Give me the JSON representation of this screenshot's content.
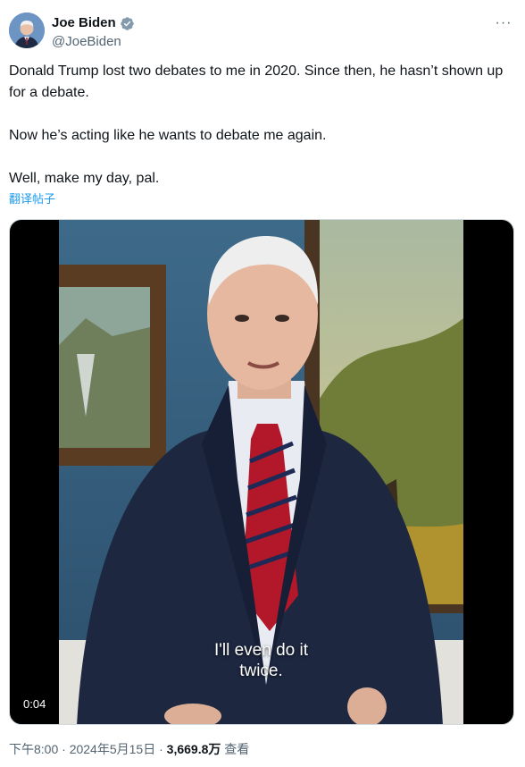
{
  "author": {
    "display_name": "Joe Biden",
    "handle": "@JoeBiden"
  },
  "icons": {
    "verified": "verified-badge-icon",
    "more": "more-horizontal-icon"
  },
  "colors": {
    "link": "#1d9bf0",
    "secondary_text": "#536471",
    "verified_badge": "#829aab"
  },
  "tweet": {
    "paragraph_1": "Donald Trump lost two debates to me in 2020. Since then, he hasn’t shown up for a debate.",
    "paragraph_2": "Now he’s acting like he wants to debate me again.",
    "paragraph_3": "Well, make my day, pal.",
    "translate_label": "翻译帖子"
  },
  "video": {
    "caption_line_1": "I'll even do it",
    "caption_line_2": "twice.",
    "duration": "0:04"
  },
  "meta": {
    "time": "下午8:00",
    "separator_1": " · ",
    "date": "2024年5月15日",
    "separator_2": " · ",
    "views_count": "3,669.8万",
    "views_label": " 查看"
  },
  "more_glyph": "···"
}
